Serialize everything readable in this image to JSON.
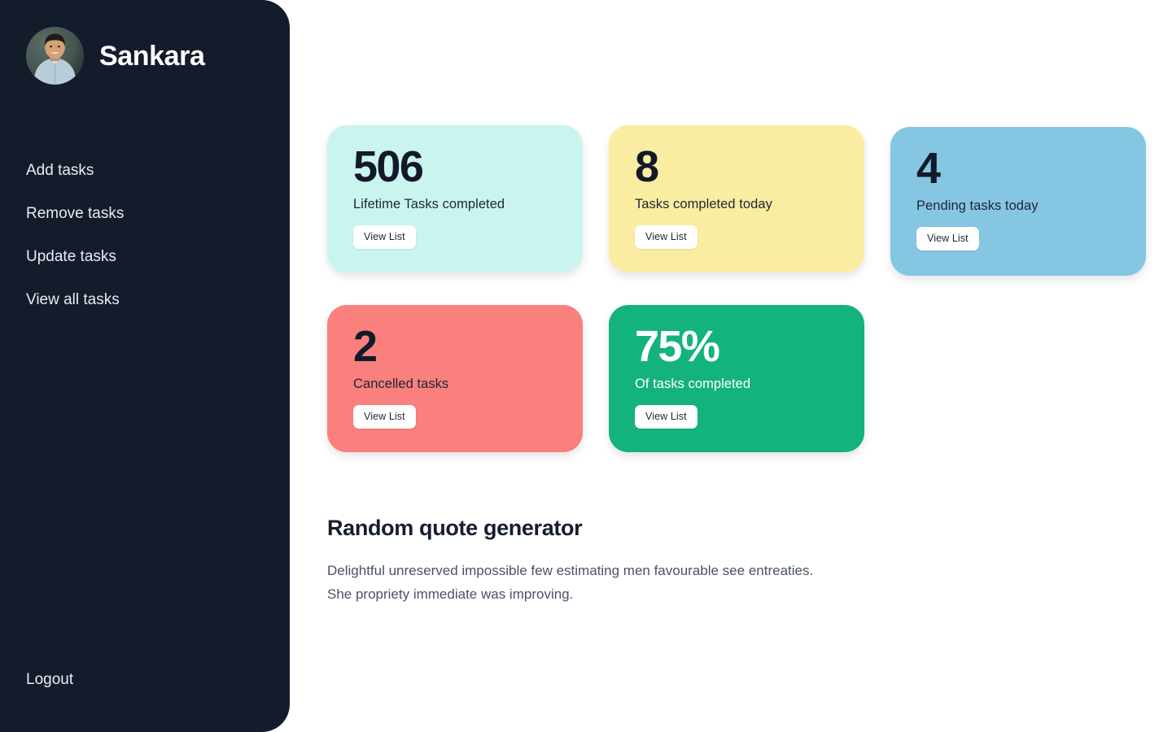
{
  "sidebar": {
    "brand_name": "Sankara",
    "avatar_alt": "user-avatar-photo",
    "nav_items": [
      {
        "label": "Add tasks"
      },
      {
        "label": "Remove tasks"
      },
      {
        "label": "Update tasks"
      },
      {
        "label": "View all tasks"
      }
    ],
    "logout_label": "Logout",
    "background_color": "#141c2c"
  },
  "cards": [
    {
      "value": "506",
      "label": "Lifetime Tasks completed",
      "button_label": "View List",
      "background_color": "#c9f5ee",
      "text_style": "dark"
    },
    {
      "value": "8",
      "label": "Tasks completed today",
      "button_label": "View List",
      "background_color": "#faeda1",
      "text_style": "dark"
    },
    {
      "value": "4",
      "label": "Pending tasks today",
      "button_label": "View List",
      "background_color": "#85c6e3",
      "text_style": "dark"
    },
    {
      "value": "2",
      "label": "Cancelled tasks",
      "button_label": "View List",
      "background_color": "#f9807c",
      "text_style": "dark"
    },
    {
      "value": "75%",
      "label": "Of tasks completed",
      "button_label": "View List",
      "background_color": "#14b37d",
      "text_style": "light"
    }
  ],
  "quote": {
    "title": "Random quote generator",
    "text": "Delightful unreserved impossible few estimating men favourable see entreaties. She propriety immediate was improving."
  }
}
